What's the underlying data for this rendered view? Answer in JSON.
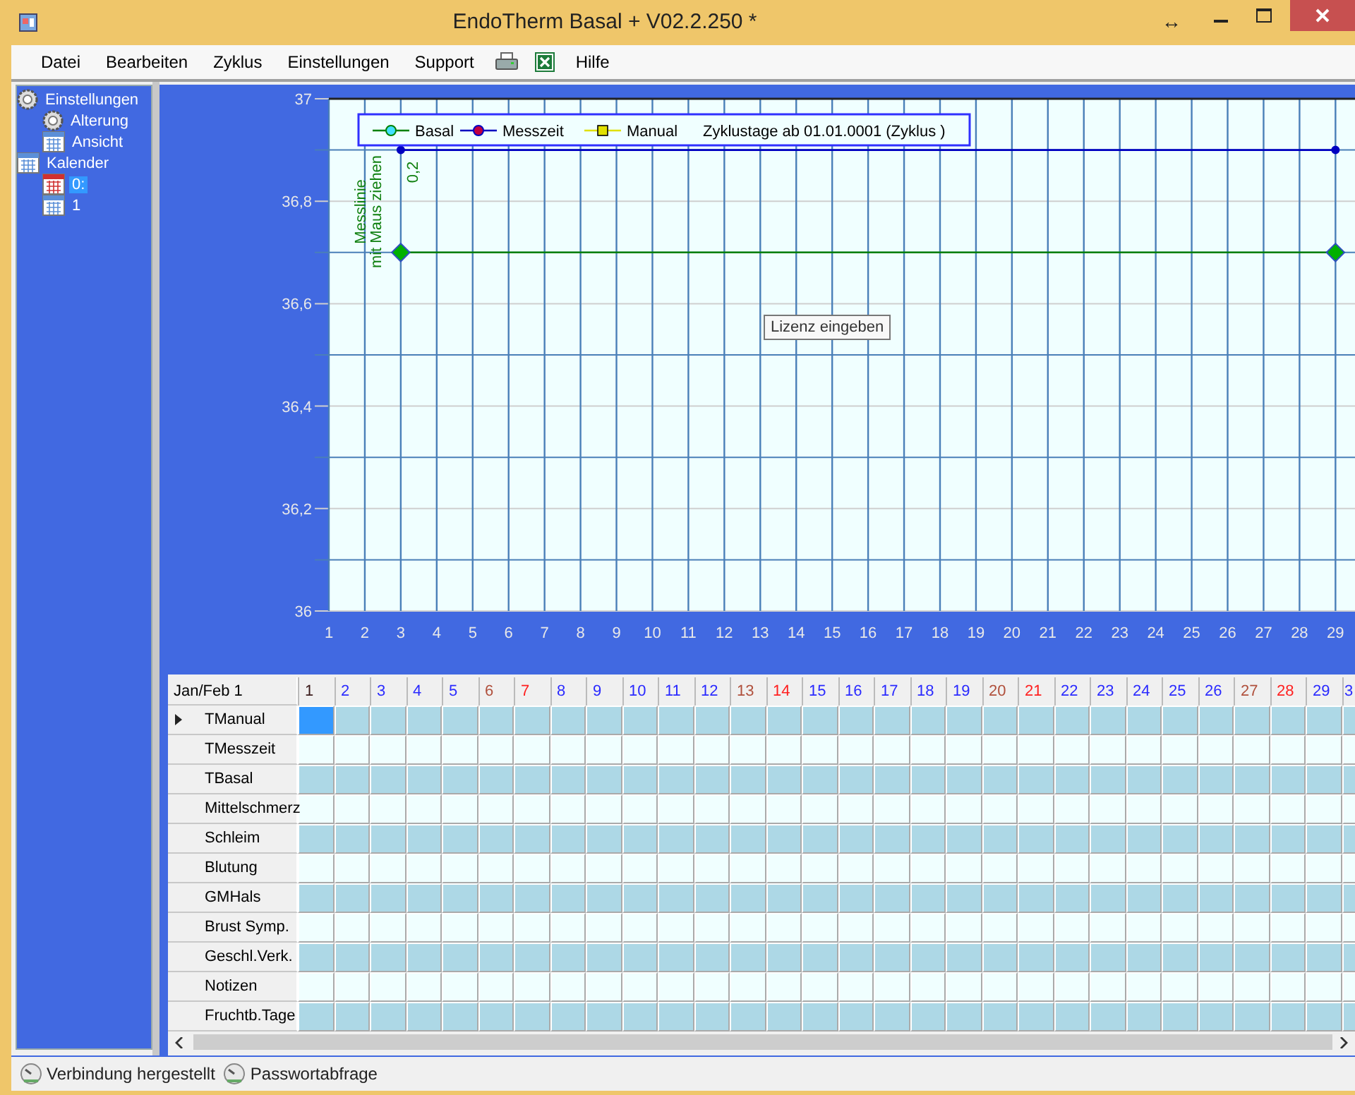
{
  "window": {
    "title": "EndoTherm Basal + V02.2.250 *",
    "resize_glyph": "↔"
  },
  "menu": {
    "items": [
      {
        "kind": "text",
        "label": "Datei"
      },
      {
        "kind": "text",
        "label": "Bearbeiten"
      },
      {
        "kind": "text",
        "label": "Zyklus"
      },
      {
        "kind": "text",
        "label": "Einstellungen"
      },
      {
        "kind": "text",
        "label": "Support"
      },
      {
        "kind": "printer"
      },
      {
        "kind": "spreadsheet"
      },
      {
        "kind": "text",
        "label": "Hilfe"
      }
    ]
  },
  "sidebar": {
    "items": [
      {
        "label": "Einstellungen",
        "kind": "gear",
        "selected": false,
        "children": [
          {
            "label": "Alterung",
            "kind": "gear",
            "selected": false
          },
          {
            "label": "Ansicht",
            "kind": "calendar",
            "selected": false
          }
        ]
      },
      {
        "label": "Kalender",
        "kind": "calendar",
        "selected": false,
        "children": [
          {
            "label": "0:",
            "kind": "calendar",
            "selected": true
          },
          {
            "label": "1",
            "kind": "calendar",
            "selected": false
          }
        ]
      }
    ]
  },
  "chart": {
    "chart_data": {
      "type": "line",
      "grid": true,
      "ref_lines": [
        {
          "axis": "y",
          "value": 36.1
        },
        {
          "axis": "y",
          "value": 36.3
        },
        {
          "axis": "y",
          "value": 36.5
        },
        {
          "axis": "y",
          "value": 36.7
        },
        {
          "axis": "y",
          "value": 36.9
        }
      ],
      "legend": "top left",
      "title": "Zyklustage ab 01.01.0001 (Zyklus )",
      "x": [
        3,
        29
      ],
      "xlim": [
        1,
        29.7
      ],
      "ylim": [
        36,
        37
      ],
      "xticks": [
        1,
        2,
        3,
        4,
        5,
        6,
        7,
        8,
        9,
        10,
        11,
        12,
        13,
        14,
        15,
        16,
        17,
        18,
        19,
        20,
        21,
        22,
        23,
        24,
        25,
        26,
        27,
        28,
        29
      ],
      "yticks": [
        {
          "value": 36,
          "label": "36"
        },
        {
          "value": 36.2,
          "label": "36,2"
        },
        {
          "value": 36.4,
          "label": "36,4"
        },
        {
          "value": 36.6,
          "label": "36,6"
        },
        {
          "value": 36.8,
          "label": "36,8"
        },
        {
          "value": 37,
          "label": "37"
        }
      ],
      "series": [
        {
          "name": "Basal",
          "color": "#008000",
          "marker": "diamond",
          "values": [
            36.7,
            36.7
          ]
        },
        {
          "name": "Messzeit",
          "color": "#0000c0",
          "marker": "circle",
          "values": [
            36.9,
            36.9
          ]
        },
        {
          "name": "Manual",
          "color": "#e0e000",
          "marker": "square",
          "values": [
            null,
            null
          ]
        }
      ]
    },
    "measure_line": {
      "label_lines": [
        "Messlinie",
        "mit Maus ziehen"
      ],
      "value": "0,2"
    },
    "tooltip": "Lizenz eingeben"
  },
  "table": {
    "corner": "Jan/Feb 1",
    "columns": [
      {
        "label": "1",
        "kind": "current"
      },
      {
        "label": "2",
        "kind": "weekday"
      },
      {
        "label": "3",
        "kind": "weekday"
      },
      {
        "label": "4",
        "kind": "weekday"
      },
      {
        "label": "5",
        "kind": "weekday"
      },
      {
        "label": "6",
        "kind": "saturday"
      },
      {
        "label": "7",
        "kind": "sunday"
      },
      {
        "label": "8",
        "kind": "weekday"
      },
      {
        "label": "9",
        "kind": "weekday"
      },
      {
        "label": "10",
        "kind": "weekday"
      },
      {
        "label": "11",
        "kind": "weekday"
      },
      {
        "label": "12",
        "kind": "weekday"
      },
      {
        "label": "13",
        "kind": "saturday"
      },
      {
        "label": "14",
        "kind": "sunday"
      },
      {
        "label": "15",
        "kind": "weekday"
      },
      {
        "label": "16",
        "kind": "weekday"
      },
      {
        "label": "17",
        "kind": "weekday"
      },
      {
        "label": "18",
        "kind": "weekday"
      },
      {
        "label": "19",
        "kind": "weekday"
      },
      {
        "label": "20",
        "kind": "saturday"
      },
      {
        "label": "21",
        "kind": "sunday"
      },
      {
        "label": "22",
        "kind": "weekday"
      },
      {
        "label": "23",
        "kind": "weekday"
      },
      {
        "label": "24",
        "kind": "weekday"
      },
      {
        "label": "25",
        "kind": "weekday"
      },
      {
        "label": "26",
        "kind": "weekday"
      },
      {
        "label": "27",
        "kind": "saturday"
      },
      {
        "label": "28",
        "kind": "sunday"
      },
      {
        "label": "29",
        "kind": "weekday"
      },
      {
        "label": "3",
        "kind": "weekday"
      }
    ],
    "rows": [
      {
        "label": "TManual",
        "selected": true
      },
      {
        "label": "TMesszeit",
        "selected": false
      },
      {
        "label": "TBasal",
        "selected": false
      },
      {
        "label": "Mittelschmerz",
        "selected": false
      },
      {
        "label": "Schleim",
        "selected": false
      },
      {
        "label": "Blutung",
        "selected": false
      },
      {
        "label": "GMHals",
        "selected": false
      },
      {
        "label": "Brust Symp.",
        "selected": false
      },
      {
        "label": "Geschl.Verk.",
        "selected": false
      },
      {
        "label": "Notizen",
        "selected": false
      },
      {
        "label": "Fruchtb.Tage",
        "selected": false
      }
    ]
  },
  "status_bar": {
    "items": [
      "Verbindung hergestellt",
      "Passwortabfrage"
    ]
  }
}
